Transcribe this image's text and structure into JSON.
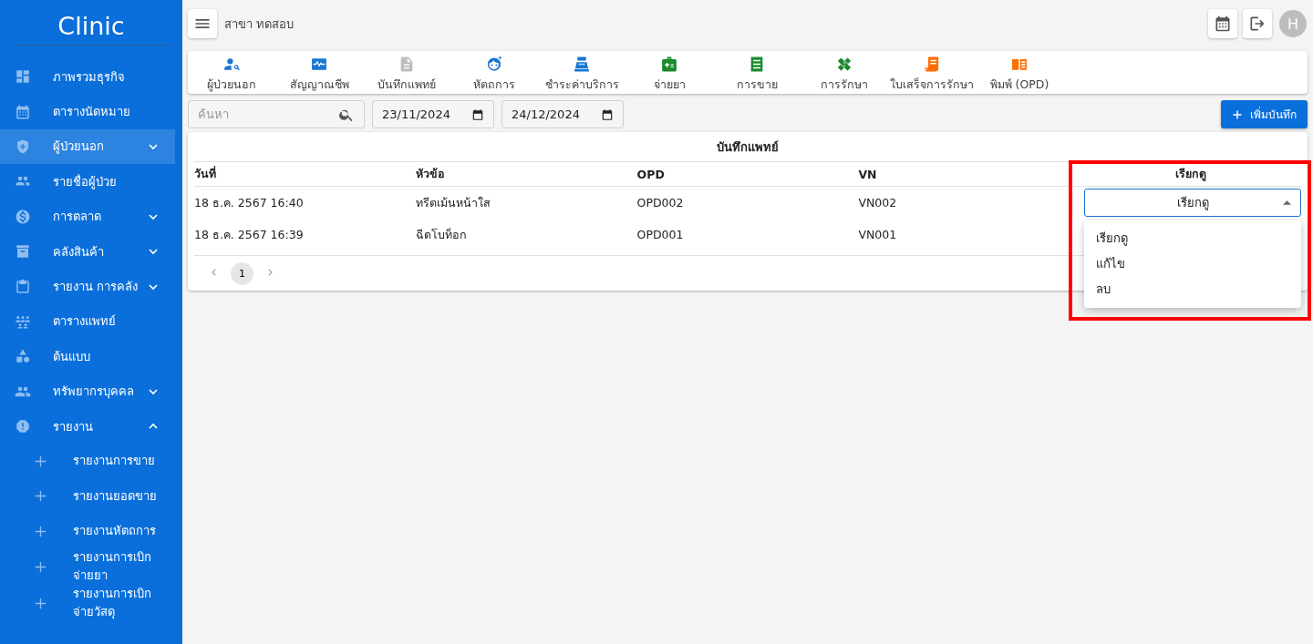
{
  "sidebar": {
    "logo": "Clinic",
    "items": [
      {
        "label": "ภาพรวมธุรกิจ",
        "selected": false
      },
      {
        "label": "ตารางนัดหมาย",
        "selected": false
      },
      {
        "label": "ผู้ป่วยนอก",
        "selected": true,
        "expanded": false
      },
      {
        "label": "รายชื่อผู้ป่วย",
        "selected": false
      },
      {
        "label": "การตลาด",
        "selected": false,
        "expanded": false
      },
      {
        "label": "คลังสินค้า",
        "selected": false,
        "expanded": false
      },
      {
        "label": "รายงาน การคลัง",
        "selected": false,
        "expanded": false
      },
      {
        "label": "ตารางแพทย์",
        "selected": false
      },
      {
        "label": "ต้นแบบ",
        "selected": false
      },
      {
        "label": "ทรัพยากรบุคคล",
        "selected": false,
        "expanded": false
      },
      {
        "label": "รายงาน",
        "selected": false,
        "expanded": true,
        "children": [
          {
            "label": "รายงานการขาย",
            "selected": false
          },
          {
            "label": "รายงานยอดขาย",
            "selected": false
          },
          {
            "label": "รายงานหัตถการ",
            "selected": false
          },
          {
            "label": "รายงานการเบิกจ่ายยา",
            "selected": false
          },
          {
            "label": "รายงานการเบิกจ่ายวัสดุ",
            "selected": false
          }
        ]
      }
    ]
  },
  "header": {
    "branch": "สาขา ทดสอบ",
    "avatar": "H"
  },
  "toolbar": [
    {
      "label": "ผู้ป่วยนอก",
      "color": "#1976d2"
    },
    {
      "label": "สัญญาณชีพ",
      "color": "#1976d2"
    },
    {
      "label": "บันทึกแพทย์",
      "color": "#bdbdbd"
    },
    {
      "label": "หัตถการ",
      "color": "#1976d2"
    },
    {
      "label": "ชำระค่าบริการ",
      "color": "#1976d2"
    },
    {
      "label": "จ่ายยา",
      "color": "#1b8a2e"
    },
    {
      "label": "การขาย",
      "color": "#1b8a2e"
    },
    {
      "label": "การรักษา",
      "color": "#1b8a2e"
    },
    {
      "label": "ใบเสร็จการรักษา",
      "color": "#ff6d00"
    },
    {
      "label": "พิมพ์ (OPD)",
      "color": "#ff6d00"
    }
  ],
  "filters": {
    "search_placeholder": "ค้นหา",
    "date_from": "23/11/2024",
    "date_to": "24/12/2024",
    "add_button": "เพิ่มบันทึก"
  },
  "table": {
    "title": "บันทึกแพทย์",
    "columns": [
      "วันที่",
      "หัวข้อ",
      "OPD",
      "VN",
      "เรียกดู"
    ],
    "rows": [
      {
        "cells": [
          "18 ธ.ค. 2567 16:40",
          "ทรีตเม้นหน้าใส",
          "OPD002",
          "VN002"
        ],
        "dropdown": {
          "value": "เรียกดู",
          "open": true,
          "options": [
            "เรียกดู",
            "แก้ไข",
            "ลบ"
          ]
        }
      },
      {
        "cells": [
          "18 ธ.ค. 2567 16:39",
          "ฉีดโบท็อก",
          "OPD001",
          "VN001"
        ]
      }
    ]
  },
  "pagination": {
    "pages": [
      {
        "label": "1",
        "selected": true
      }
    ]
  }
}
